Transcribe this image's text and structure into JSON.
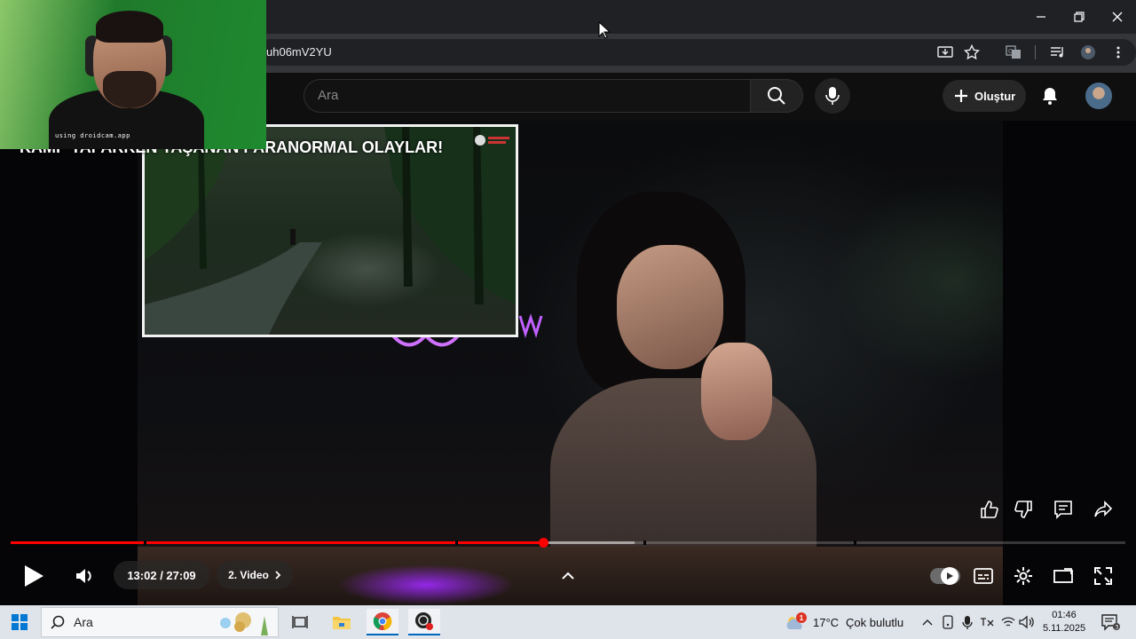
{
  "browser": {
    "url": "uh06mV2YU",
    "window_controls": [
      "minimize",
      "restore",
      "close"
    ],
    "toolbar_icons": [
      "cast-icon",
      "star-icon",
      "translate-icon",
      "media-icon",
      "extensions-icon",
      "menu-icon"
    ]
  },
  "youtube": {
    "search_placeholder": "Ara",
    "create_label": "Oluştur"
  },
  "video": {
    "clip_title": "KAMP YAPARKEN YAŞANAN PARANORMAL OLAYLAR!",
    "webcam_watermark": "using droidcam.app",
    "time": "13:02 / 27:09",
    "chapter_label": "2. Video",
    "progress_played": 0.4785,
    "progress_buffered": 0.5595
  },
  "taskbar": {
    "search_placeholder": "Ara",
    "weather_temp": "17°C",
    "weather_text": "Çok bulutlu",
    "weather_badge": "1",
    "time": "01:46",
    "date": "5.11.2025",
    "notification_count": "3"
  },
  "colors": {
    "progress": "#ff0000",
    "youtube_bg": "#0f0f0f",
    "taskbar_bg": "#dfe3ea",
    "webcam_green": "#1f8a2f"
  }
}
